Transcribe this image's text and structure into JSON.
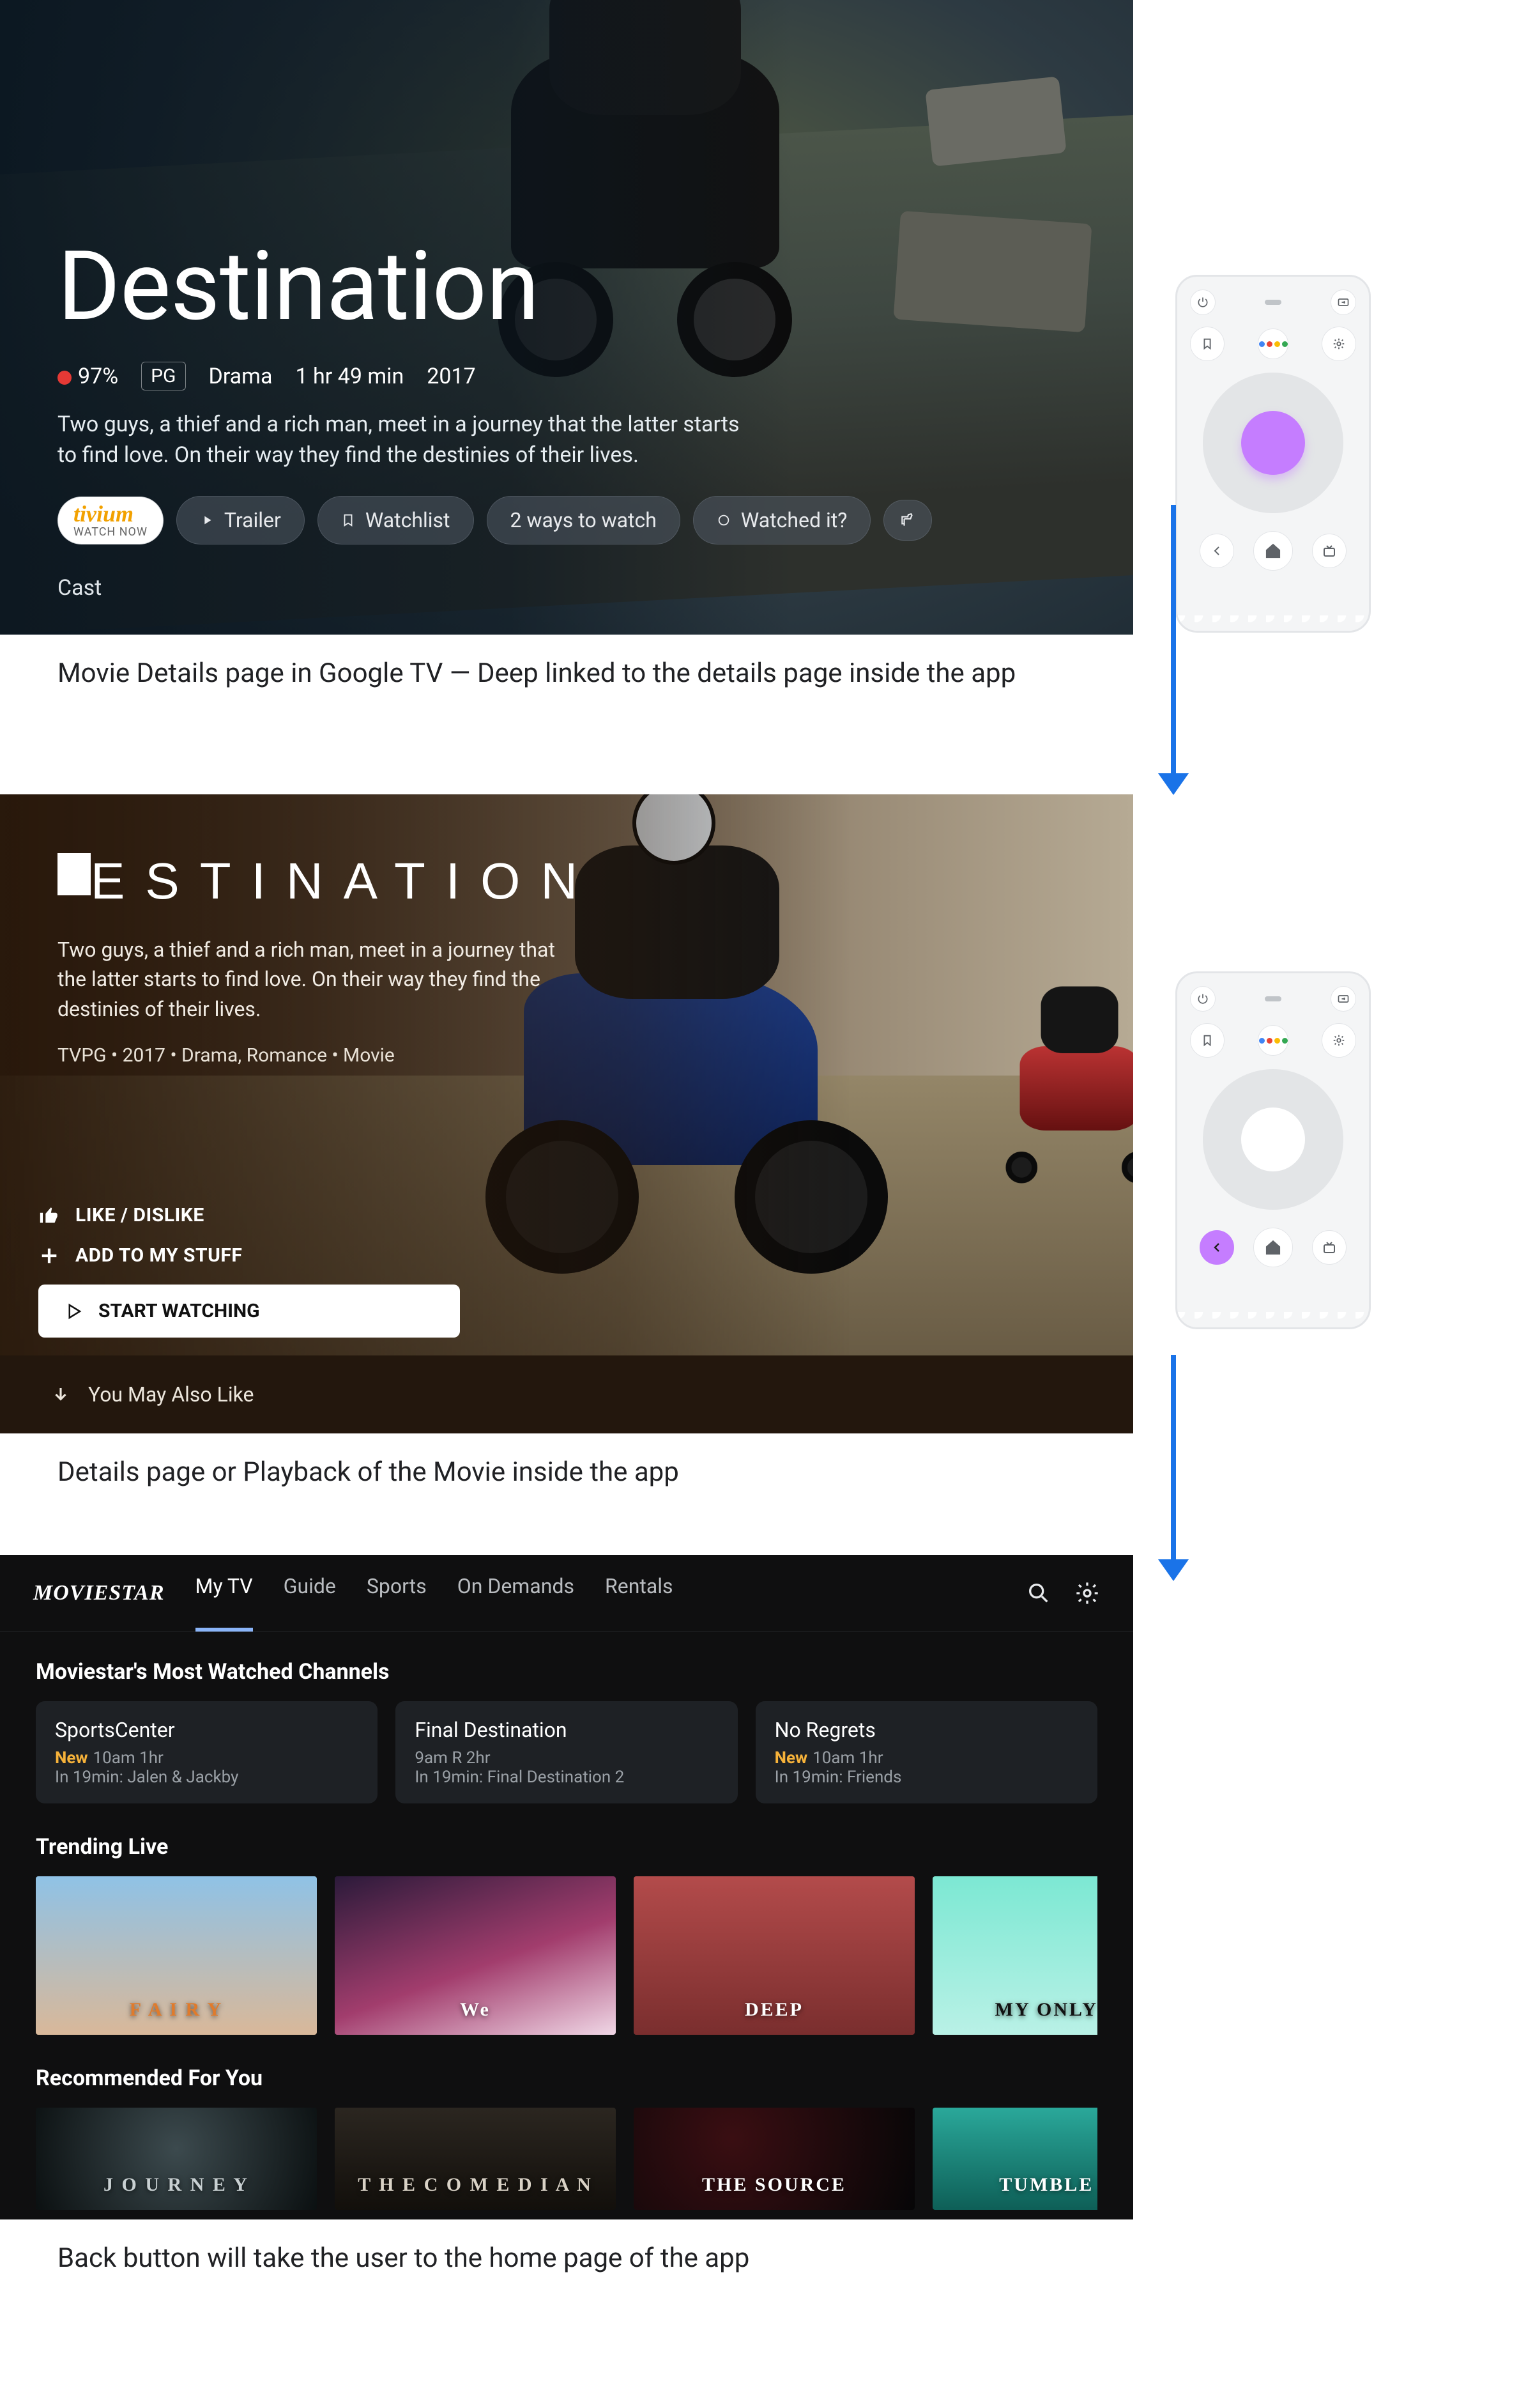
{
  "screens": {
    "gtv": {
      "title": "Destination",
      "score": "97%",
      "rating": "PG",
      "genre": "Drama",
      "runtime": "1 hr 49 min",
      "year": "2017",
      "synopsis": "Two guys, a thief and a rich man, meet in a journey that the latter starts to find love. On their way they find the destinies of their lives.",
      "primary_provider": {
        "brand": "tivium",
        "sub": "WATCH NOW"
      },
      "buttons": {
        "trailer": "Trailer",
        "watchlist": "Watchlist",
        "ways": "2 ways to watch",
        "watched": "Watched it?"
      },
      "cast_label": "Cast"
    },
    "app_details": {
      "title": "DESTINATION",
      "synopsis": "Two guys, a thief and a rich man, meet in a journey that the latter starts to find love. On their way they find the destinies of their lives.",
      "meta": "TVPG • 2017 • Drama, Romance • Movie",
      "like": "LIKE / DISLIKE",
      "add": "ADD TO MY STUFF",
      "start": "START WATCHING",
      "also": "You May Also Like"
    },
    "app_home": {
      "brand": "MOVIESTAR",
      "tabs": [
        "My TV",
        "Guide",
        "Sports",
        "On Demands",
        "Rentals"
      ],
      "active_tab": 0,
      "section1_title": "Moviestar's Most Watched Channels",
      "channels": [
        {
          "title": "SportsCenter",
          "new": true,
          "time": "10am 1hr",
          "next": "In 19min: Jalen & Jackby"
        },
        {
          "title": "Final Destination",
          "new": false,
          "time": "9am R 2hr",
          "next": "In 19min: Final Destination 2"
        },
        {
          "title": "No Regrets",
          "new": true,
          "time": "10am 1hr",
          "next": "In 19min: Friends"
        }
      ],
      "section2_title": "Trending Live",
      "trending": [
        {
          "label": "F A I R Y",
          "bg": "linear-gradient(#8fc2e6,#d9b899)",
          "accent": "#e07b2c"
        },
        {
          "label": "We",
          "bg": "linear-gradient(160deg,#2b1a3a,#a23d6d 55%,#f0d7e6)",
          "accent": "#fff"
        },
        {
          "label": "DEEP",
          "bg": "linear-gradient(#b34b4b,#7a2e2e)",
          "accent": "#fff"
        },
        {
          "label": "MY ONLY ONE",
          "bg": "linear-gradient(#7ce8d3,#b9f1e6)",
          "accent": "#111"
        }
      ],
      "section3_title": "Recommended For You",
      "recs": [
        {
          "label": "J O U R N E Y",
          "bg": "radial-gradient(circle at 50% 40%,#3c4a4e,#0b1011)",
          "accent": "#c8d0d2"
        },
        {
          "label": "T H E   C O M E D I A N",
          "bg": "linear-gradient(#2b2620,#120f0b)",
          "accent": "#d9d2c6"
        },
        {
          "label": "THE SOURCE",
          "bg": "radial-gradient(circle at 35% 30%,#3a0e12,#060607)",
          "accent": "#fff"
        },
        {
          "label": "TUMBLE DRY",
          "bg": "linear-gradient(#2aa89a,#0e5f57)",
          "accent": "#fff"
        }
      ]
    }
  },
  "captions": {
    "c1": "Movie Details page in Google TV — Deep linked to the details page inside the app",
    "c2": "Details page or Playback of the Movie inside the app",
    "c3": "Back button will take the user to the home page of the app"
  },
  "strings": {
    "new": "New"
  },
  "colors": {
    "assist_dots": [
      "#4285f4",
      "#ea4335",
      "#fbbc04",
      "#34a853"
    ]
  }
}
